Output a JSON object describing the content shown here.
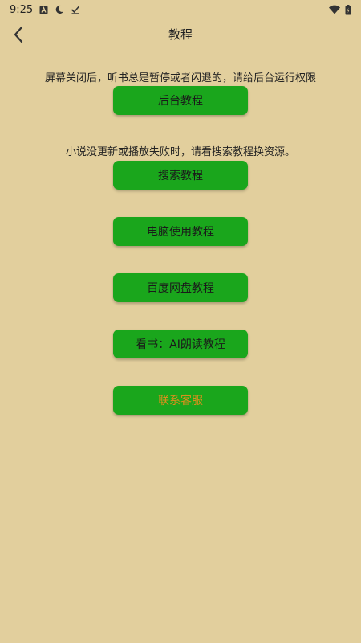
{
  "status_bar": {
    "time": "9:25",
    "icons_left": [
      "notification-a-icon",
      "moon-icon",
      "check-icon"
    ],
    "icons_right": [
      "wifi-icon",
      "battery-icon"
    ]
  },
  "app_bar": {
    "title": "教程",
    "back_icon": "chevron-left-icon"
  },
  "sections": [
    {
      "hint": "屏幕关闭后，听书总是暂停或者闪退的，请给后台运行权限",
      "button": "后台教程"
    },
    {
      "hint": "小说没更新或播放失败时，请看搜索教程换资源。",
      "button": "搜索教程"
    }
  ],
  "buttons": [
    {
      "label": "电脑使用教程"
    },
    {
      "label": "百度网盘教程"
    },
    {
      "label": "看书：AI朗读教程"
    },
    {
      "label": "联系客服"
    }
  ],
  "colors": {
    "background": "#e2cf9d",
    "button": "#1aa61c",
    "contact_text": "#d9901c"
  }
}
